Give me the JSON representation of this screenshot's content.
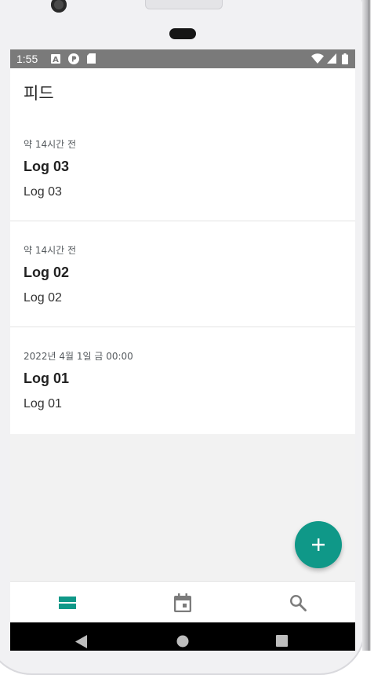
{
  "status_bar": {
    "time": "1:55",
    "icons": [
      "a-notification-icon",
      "p-notification-icon",
      "sd-card-icon",
      "wifi-icon",
      "signal-icon",
      "battery-icon"
    ]
  },
  "app_bar": {
    "title": "피드"
  },
  "feed": {
    "items": [
      {
        "time": "약 14시간 전",
        "title": "Log 03",
        "body": "Log 03"
      },
      {
        "time": "약 14시간 전",
        "title": "Log 02",
        "body": "Log 02"
      },
      {
        "time": "2022년 4월 1일 금 00:00",
        "title": "Log 01",
        "body": "Log 01"
      }
    ]
  },
  "fab": {
    "icon": "add-icon"
  },
  "bottom_nav": {
    "items": [
      {
        "icon": "feed-list-icon",
        "active": true
      },
      {
        "icon": "calendar-icon",
        "active": false
      },
      {
        "icon": "search-icon",
        "active": false
      }
    ]
  },
  "system_nav": {
    "buttons": [
      "back-icon",
      "home-icon",
      "recents-icon"
    ]
  },
  "colors": {
    "accent": "#0f9888",
    "status_bar": "#7a7a7a",
    "background": "#f2f2f2",
    "inactive_icon": "#7b7b7b"
  }
}
